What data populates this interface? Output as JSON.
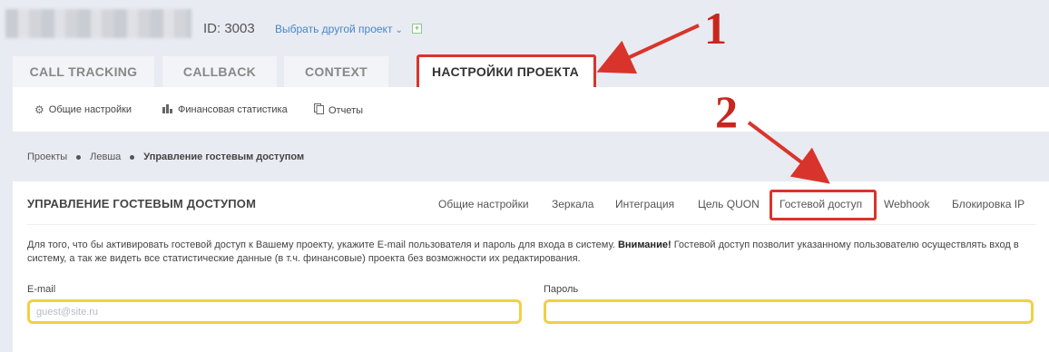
{
  "header": {
    "project_id": "ID: 3003",
    "choose_project_label": "Выбрать другой проект",
    "add_label": "+"
  },
  "main_tabs": [
    {
      "label": "CALL TRACKING"
    },
    {
      "label": "CALLBACK"
    },
    {
      "label": "CONTEXT"
    },
    {
      "label": "НАСТРОЙКИ ПРОЕКТА",
      "active": true
    }
  ],
  "subnav": [
    {
      "label": "Общие настройки",
      "icon": "gear-icon"
    },
    {
      "label": "Финансовая статистика",
      "icon": "bar-chart-icon"
    },
    {
      "label": "Отчеты",
      "icon": "report-icon"
    }
  ],
  "breadcrumb": [
    "Проекты",
    "Левша",
    "Управление гостевым доступом"
  ],
  "panel": {
    "title": "УПРАВЛЕНИЕ ГОСТЕВЫМ ДОСТУПОМ",
    "tabs": [
      {
        "label": "Общие настройки"
      },
      {
        "label": "Зеркала"
      },
      {
        "label": "Интеграция"
      },
      {
        "label": "Цель QUON"
      },
      {
        "label": "Гостевой доступ",
        "active": true
      },
      {
        "label": "Webhook"
      },
      {
        "label": "Блокировка IP"
      }
    ],
    "notice_text": "Для того, что бы активировать гостевой доступ к Вашему проекту, укажите E-mail пользователя и пароль для входа в систему.",
    "notice_bold": "Внимание!",
    "notice_rest": "Гостевой доступ позволит указанному пользователю осуществлять вход в систему, а так же видеть все статистические данные (в т.ч. финансовые) проекта без возможности их редактирования.",
    "email_label": "E-mail",
    "email_placeholder": "guest@site.ru",
    "email_value": "",
    "password_label": "Пароль",
    "password_value": ""
  },
  "annotations": {
    "step1": "1",
    "step2": "2",
    "color": "#d9342b",
    "highlight_color": "#f2cf45"
  }
}
